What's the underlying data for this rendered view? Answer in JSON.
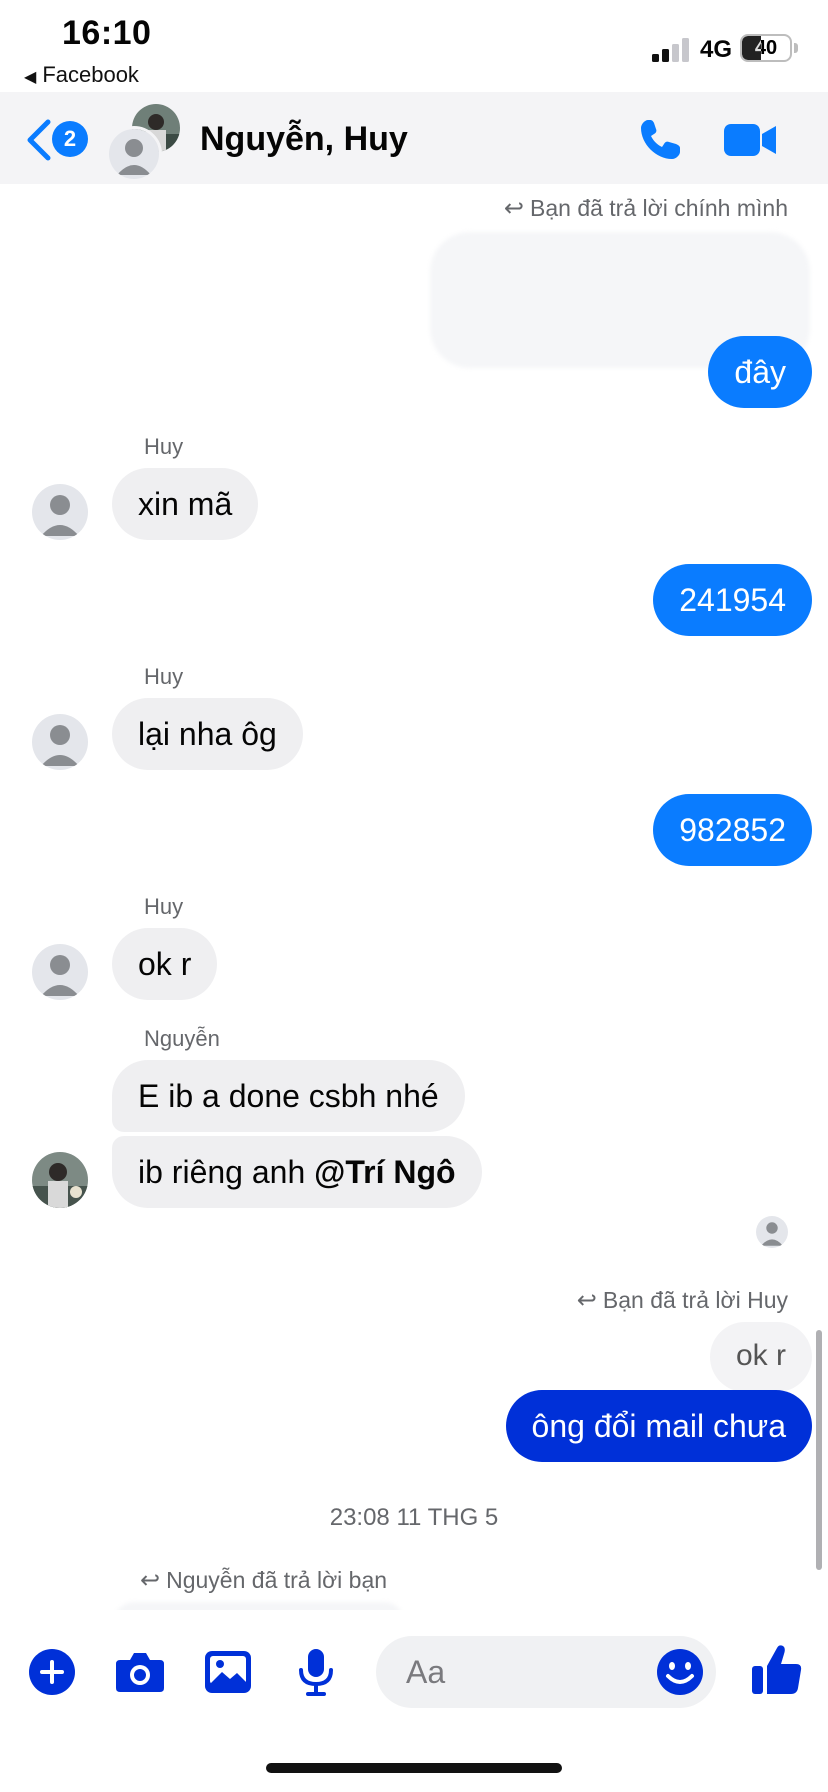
{
  "status_bar": {
    "time": "16:10",
    "back_app": "Facebook",
    "network": "4G",
    "battery": "40",
    "battery_level": 0.4
  },
  "header": {
    "unread_count": "2",
    "title": "Nguyễn, Huy",
    "icons": [
      "back-chevron-icon",
      "phone-icon",
      "video-camera-icon"
    ]
  },
  "messages": {
    "reply_note_1": "Bạn đã trả lời chính mình",
    "out_1": "đây",
    "sender_huy_1": "Huy",
    "in_1": "xin mã",
    "out_2": "241954",
    "sender_huy_2": "Huy",
    "in_2": "lại nha ôg",
    "out_3": "982852",
    "sender_huy_3": "Huy",
    "in_3": "ok r",
    "sender_nguyen": "Nguyễn",
    "in_4": "E ib a done csbh nhé",
    "in_5_text": "ib riêng anh ",
    "in_5_mention": "@Trí Ngô",
    "reply_note_2": "Bạn đã trả lời Huy",
    "quoted_reply": "ok r",
    "out_4": "ông đổi mail chưa",
    "timestamp": "23:08 11 THG 5",
    "reply_note_3": "Nguyễn đã trả lời bạn"
  },
  "composer": {
    "placeholder": "Aa",
    "tools": [
      "plus-icon",
      "camera-icon",
      "photo-icon",
      "microphone-icon",
      "emoji-icon",
      "thumbs-up-icon"
    ]
  },
  "colors": {
    "accent": "#0a7cff",
    "outgoing_dark": "#0030d8",
    "incoming": "#efeff1"
  }
}
